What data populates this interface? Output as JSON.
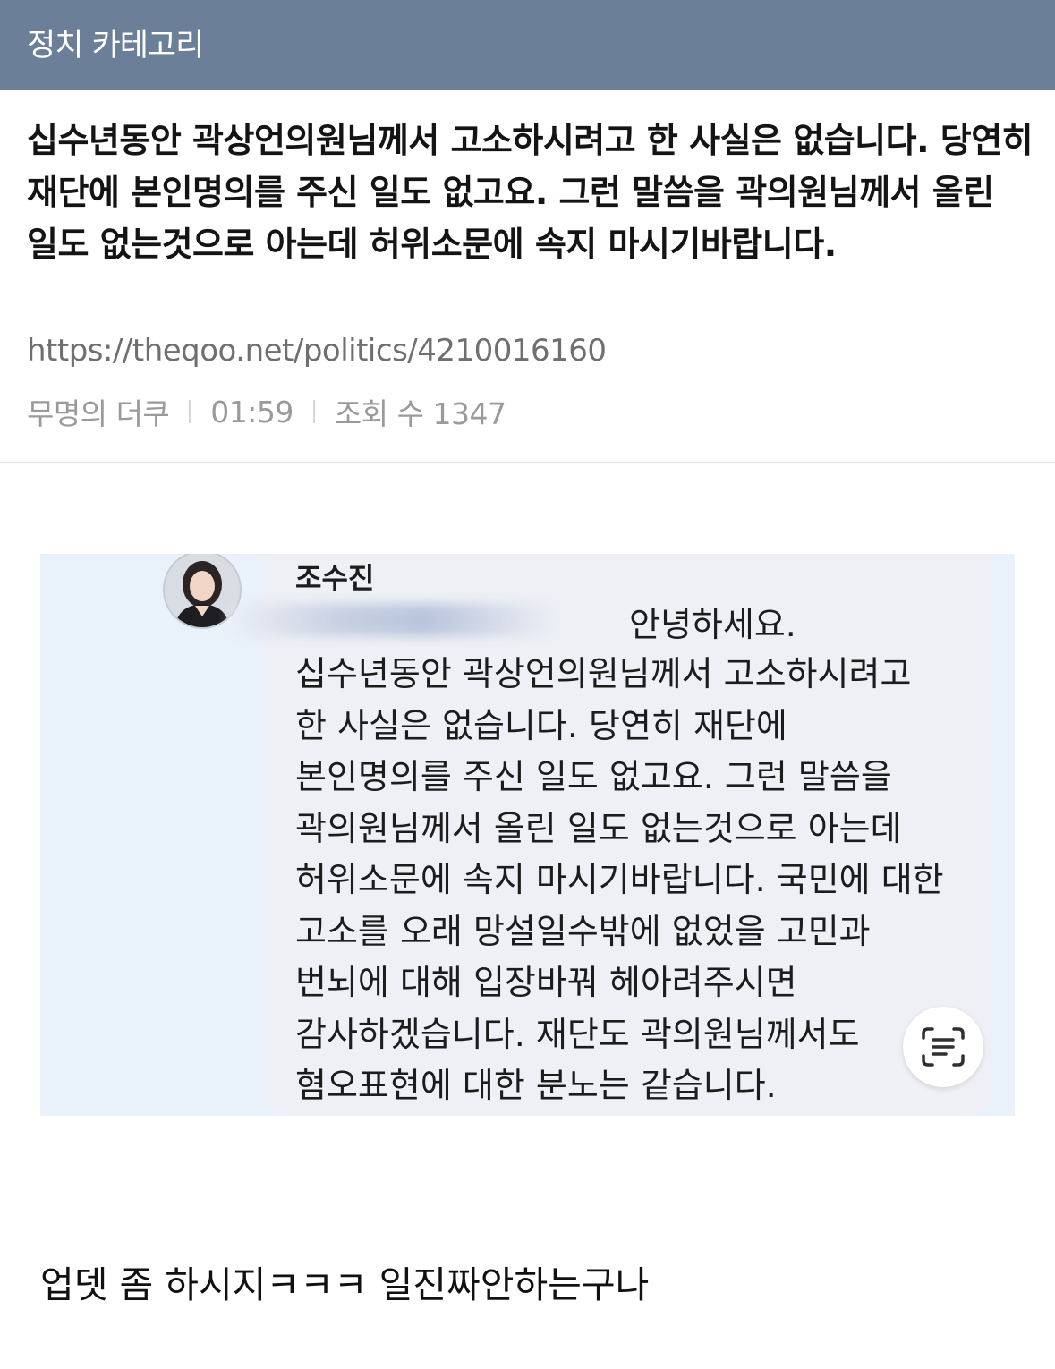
{
  "header": {
    "category": "정치 카테고리"
  },
  "post": {
    "title": "십수년동안 곽상언의원님께서 고소하시려고 한 사실은 없습니다. 당연히 재단에 본인명의를 주신 일도 없고요. 그런 말씀을 곽의원님께서 올린 일도 없는것으로 아는데 허위소문에 속지 마시기바랍니다.",
    "url": "https://theqoo.net/politics/4210016160",
    "author": "무명의 더쿠",
    "time": "01:59",
    "views": "조회 수 1347"
  },
  "screenshot": {
    "sender": "조수진",
    "greeting": "안녕하세요.",
    "lines": [
      "십수년동안 곽상언의원님께서 고소하시려고",
      "한 사실은 없습니다. 당연히 재단에",
      "본인명의를 주신 일도 없고요. 그런 말씀을",
      "곽의원님께서 올린 일도 없는것으로 아는데",
      "허위소문에 속지 마시기바랍니다. 국민에 대한",
      "고소를 오래 망설일수밖에 없었을 고민과",
      "번뇌에 대해 입장바꿔 헤아려주시면",
      "감사하겠습니다. 재단도 곽의원님께서도",
      "혐오표현에 대한 분노는 같습니다."
    ],
    "scan_icon": "live-text-scan-icon"
  },
  "comment": "업뎃 좀 하시지ㅋㅋㅋ 일진짜안하는구나"
}
